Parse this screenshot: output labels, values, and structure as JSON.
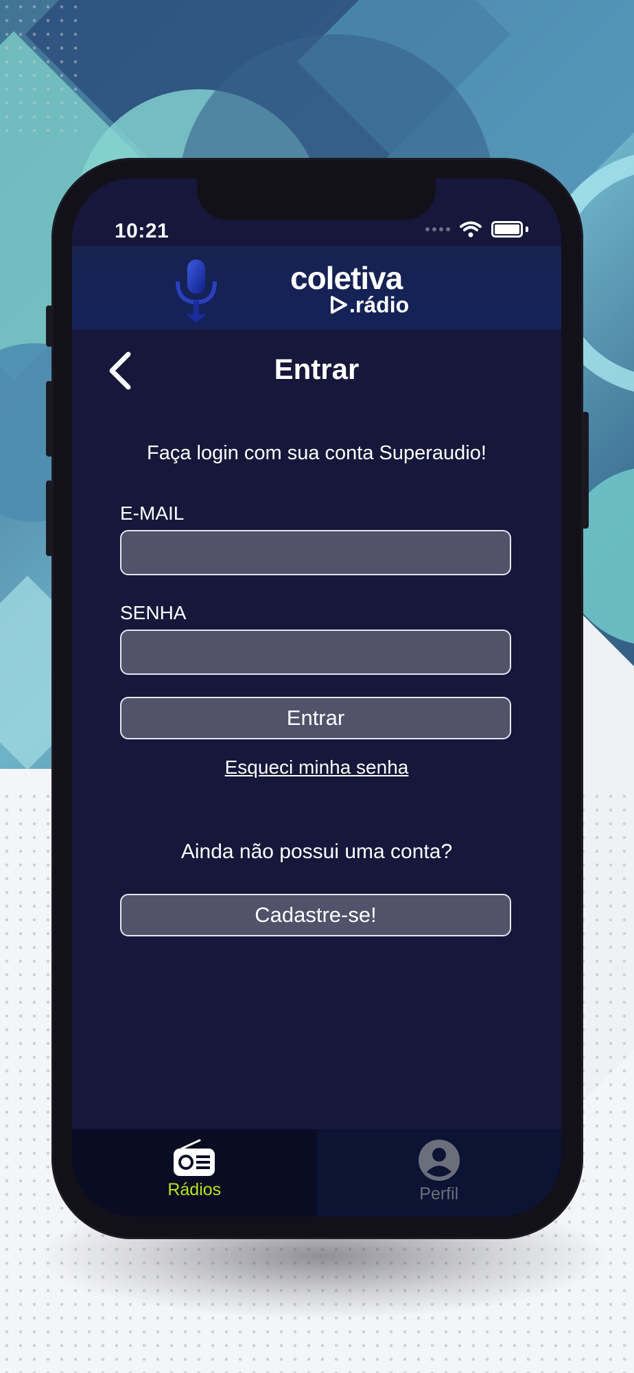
{
  "status_bar": {
    "time": "10:21"
  },
  "header": {
    "logo_main": "coletiva",
    "logo_sub": ".rádio"
  },
  "login": {
    "title": "Entrar",
    "subtitle": "Faça login com sua conta Superaudio!",
    "email_label": "E-MAIL",
    "email_value": "",
    "password_label": "SENHA",
    "password_value": "",
    "submit_label": "Entrar",
    "forgot_label": "Esqueci minha senha",
    "no_account_text": "Ainda não possui uma conta?",
    "signup_label": "Cadastre-se!"
  },
  "tabbar": {
    "tabs": [
      {
        "label": "Rádios",
        "icon": "radio-icon",
        "active": true
      },
      {
        "label": "Perfil",
        "icon": "profile-icon",
        "active": false
      }
    ]
  },
  "colors": {
    "screen_bg": "#16173a",
    "field_bg": "#52526b",
    "active_tab": "#b5e61d",
    "inactive_tab": "#6b6f7c"
  }
}
